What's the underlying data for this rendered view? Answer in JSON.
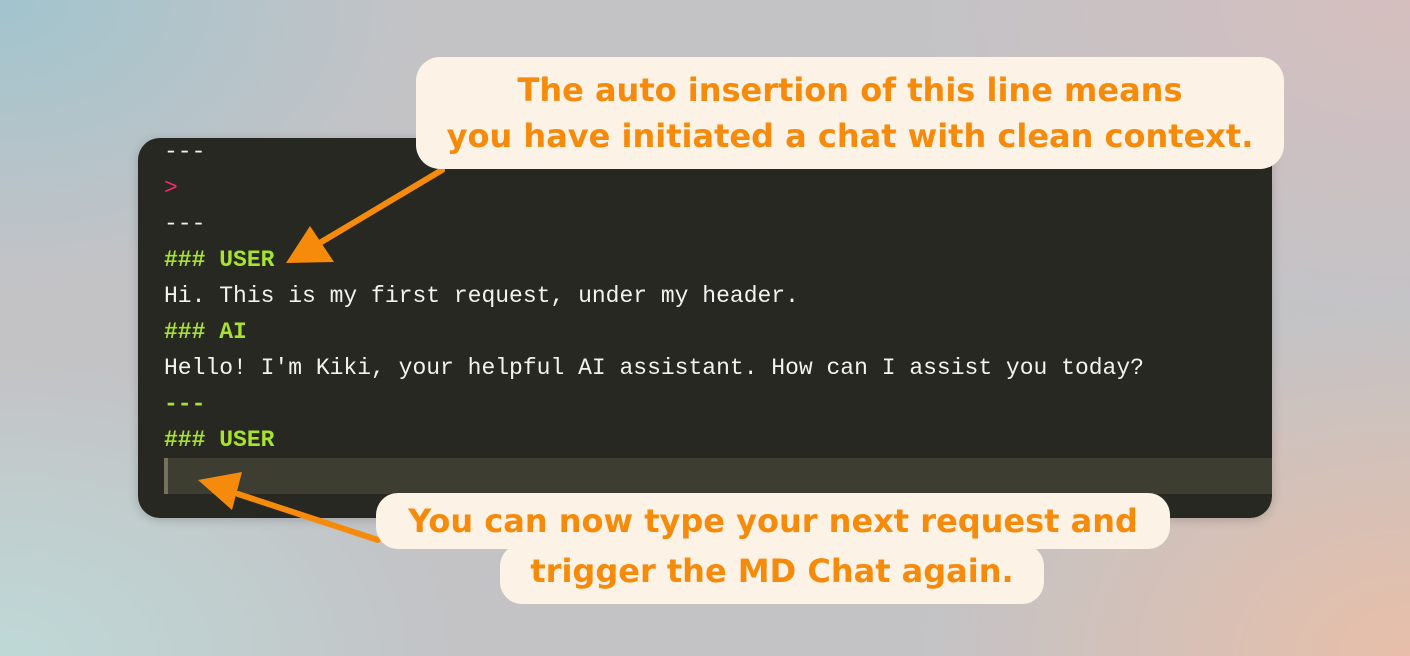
{
  "editor": {
    "lines": [
      {
        "text": "---",
        "color": "#f2f2ef"
      },
      {
        "text": ">",
        "color": "#f92672"
      },
      {
        "text": "---",
        "color": "#f2f2ef"
      },
      {
        "text": "### USER",
        "color": "#a6e22e"
      },
      {
        "text": "Hi. This is my first request, under my header.",
        "color": "#f2f2ef"
      },
      {
        "text": "### AI",
        "color": "#a6e22e"
      },
      {
        "text": "Hello! I'm Kiki, your helpful AI assistant. How can I assist you today?",
        "color": "#f2f2ef"
      },
      {
        "text": "---",
        "color": "#a6e22e"
      },
      {
        "text": "### USER",
        "color": "#a6e22e"
      }
    ],
    "background": "#272822",
    "active_line_background": "#3e3d32"
  },
  "callouts": {
    "top": {
      "line1": "The auto insertion of this line means",
      "line2": "you have initiated a chat with clean context."
    },
    "bottom": {
      "line1": "You can now type your next request and",
      "line2": "trigger the MD Chat again."
    },
    "text_color": "#f68a0a",
    "background": "#fdf2e6"
  }
}
